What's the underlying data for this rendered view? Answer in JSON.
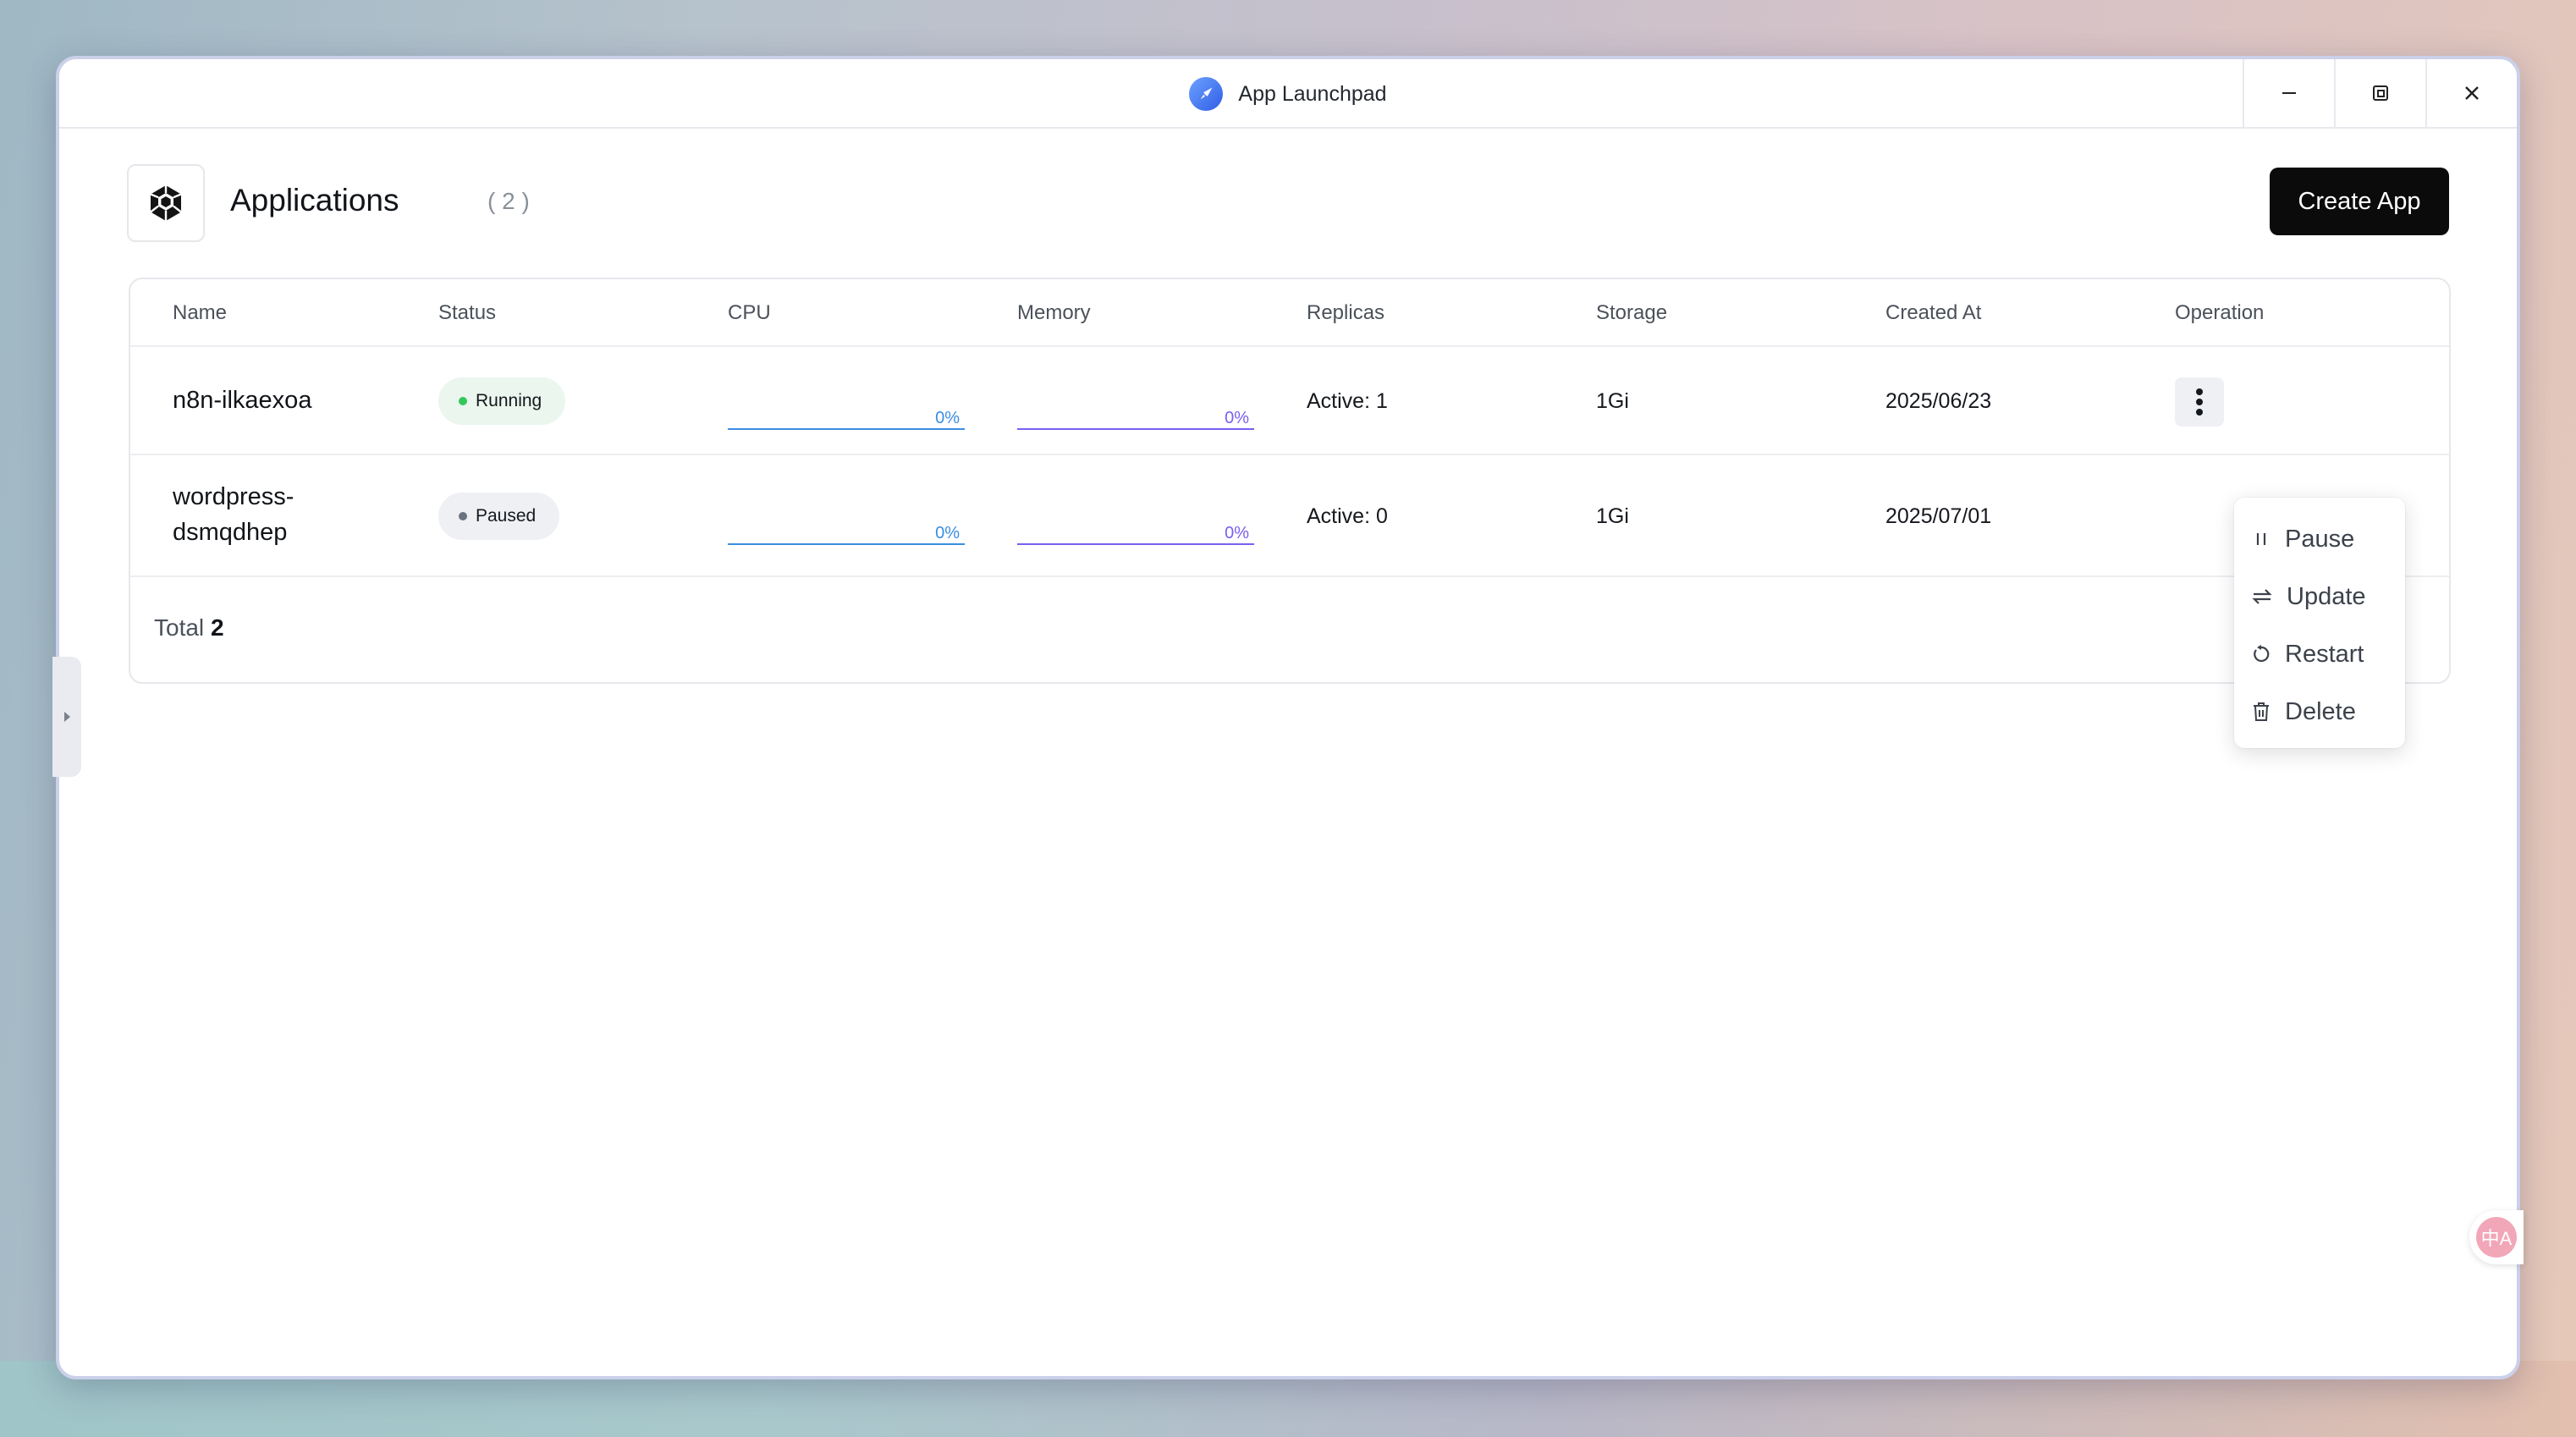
{
  "window": {
    "title": "App Launchpad"
  },
  "header": {
    "title": "Applications",
    "count": "( 2 )",
    "create_label": "Create App"
  },
  "table": {
    "columns": [
      "Name",
      "Status",
      "CPU",
      "Memory",
      "Replicas",
      "Storage",
      "Created At",
      "Operation"
    ],
    "rows": [
      {
        "name_line1": "n8n-ilkaexoa",
        "name_line2": "",
        "status": "Running",
        "status_color": "#34c759",
        "cpu": "0%",
        "memory": "0%",
        "replicas": "Active: 1",
        "storage": "1Gi",
        "created": "2025/06/23"
      },
      {
        "name_line1": "wordpress-",
        "name_line2": "dsmqdhep",
        "status": "Paused",
        "status_color": "#6b7280",
        "cpu": "0%",
        "memory": "0%",
        "replicas": "Active: 0",
        "storage": "1Gi",
        "created": "2025/07/01"
      }
    ],
    "total_label": "Total",
    "total_value": "2"
  },
  "menu": {
    "items": [
      "Pause",
      "Update",
      "Restart",
      "Delete"
    ]
  },
  "colors": {
    "cpu_line": "#3b8de0",
    "memory_line": "#7a5ff0",
    "running_badge_bg": "#eaf6ee",
    "paused_badge_bg": "#eef0f3"
  },
  "icons": {
    "translate": "中A"
  }
}
